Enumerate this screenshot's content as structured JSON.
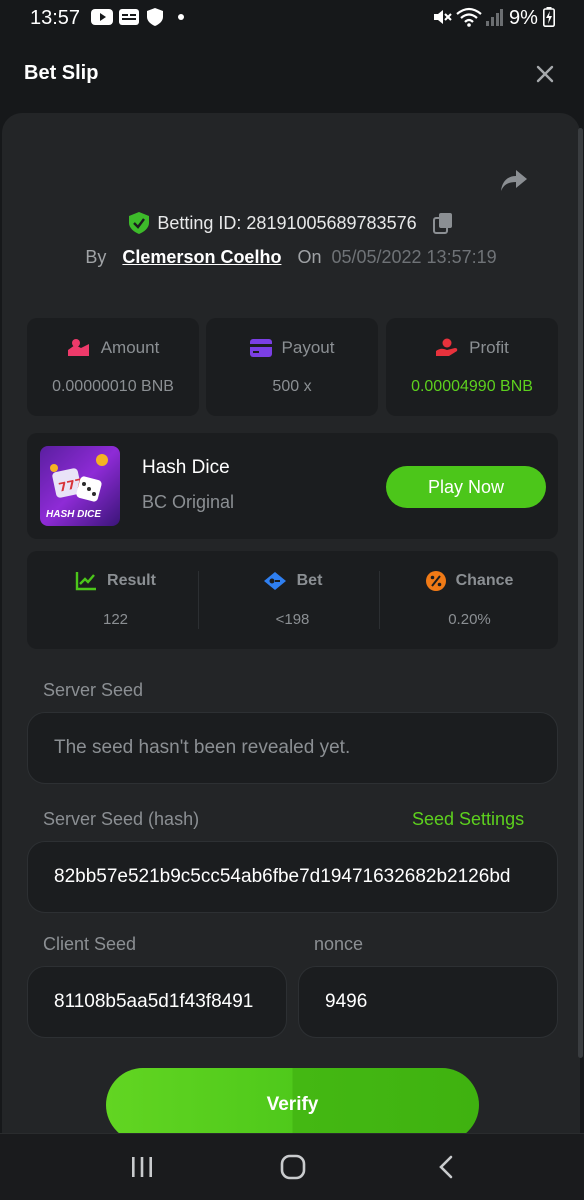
{
  "status_bar": {
    "time": "13:57",
    "battery": "9%",
    "left_icons": [
      "youtube-icon",
      "caption-icon",
      "shield-icon",
      "dot-icon"
    ],
    "right_icons": [
      "mute-icon",
      "wifi-icon",
      "signal-icon",
      "battery-icon"
    ]
  },
  "header": {
    "title": "Bet Slip"
  },
  "bet": {
    "betting_id_label": "Betting ID: 28191005689783576",
    "by_label": "By",
    "user": "Clemerson Coelho",
    "on_label": "On",
    "date": "05/05/2022 13:57:19"
  },
  "stats": {
    "amount": {
      "label": "Amount",
      "value": "0.00000010 BNB"
    },
    "payout": {
      "label": "Payout",
      "value": "500 x"
    },
    "profit": {
      "label": "Profit",
      "value": "0.00004990 BNB"
    }
  },
  "game": {
    "name": "Hash Dice",
    "subtitle": "BC Original",
    "thumb_label": "HASH DICE",
    "play_label": "Play Now"
  },
  "result": {
    "result_label": "Result",
    "result_value": "122",
    "bet_label": "Bet",
    "bet_value": "<198",
    "chance_label": "Chance",
    "chance_value": "0.20%"
  },
  "seeds": {
    "server_seed_label": "Server Seed",
    "server_seed_value": "The seed hasn't been revealed yet.",
    "server_hash_label": "Server Seed (hash)",
    "seed_settings_label": "Seed Settings",
    "server_hash_value": "82bb57e521b9c5cc54ab6fbe7d19471632682b2126bd",
    "client_seed_label": "Client Seed",
    "client_seed_value": "81108b5aa5d1f43f8491",
    "nonce_label": "nonce",
    "nonce_value": "9496"
  },
  "verify_label": "Verify",
  "colors": {
    "accent_green": "#5dd01e",
    "panel_bg": "#232527",
    "card_bg": "#1b1d1f",
    "page_bg": "#16181a"
  }
}
